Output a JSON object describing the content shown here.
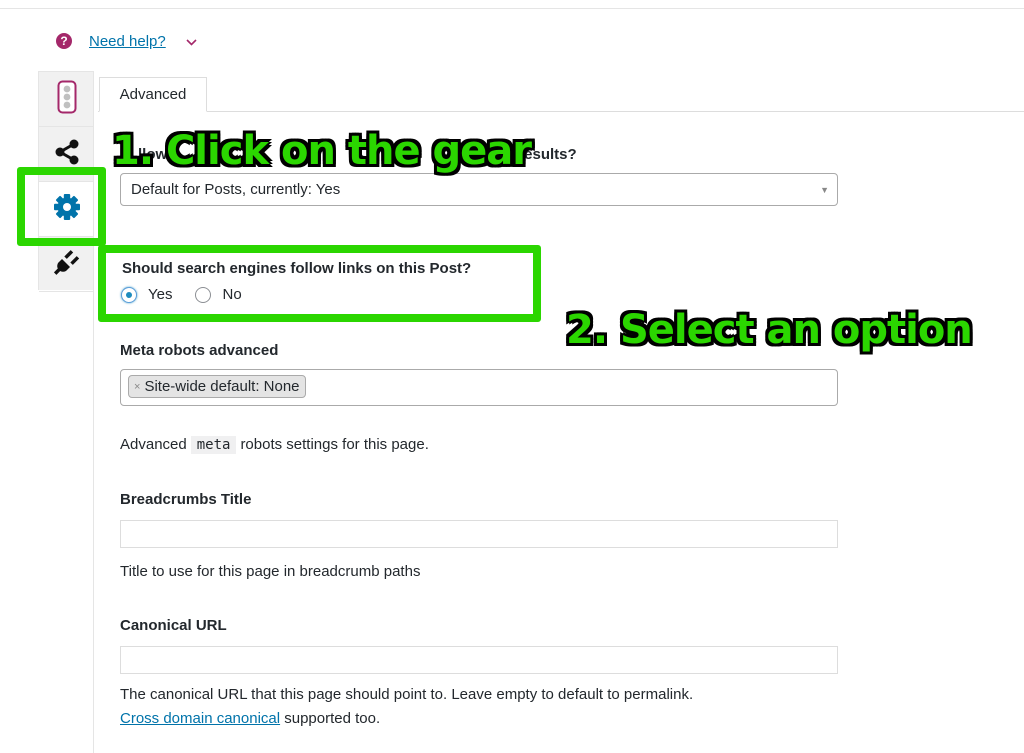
{
  "help": {
    "link_text": "Need help?",
    "icon": "question-circle-icon",
    "chevron": "chevron-down-icon"
  },
  "side_tabs": [
    {
      "name": "readability",
      "icon": "traffic-light-icon",
      "active": false
    },
    {
      "name": "social",
      "icon": "share-icon",
      "active": false
    },
    {
      "name": "advanced",
      "icon": "gear-icon",
      "active": true
    },
    {
      "name": "plugins",
      "icon": "plug-icon",
      "active": false
    }
  ],
  "tab": {
    "label": "Advanced"
  },
  "annotations": {
    "step1": "1. Click on the gear",
    "step2": "2. Select an option",
    "color": "#2bd600"
  },
  "search_results": {
    "label_visible_start": "llow",
    "label_visible_middle": "n",
    "label_visible_end": "h results?",
    "selected": "Default for Posts, currently: Yes"
  },
  "follow_links": {
    "label": "Should search engines follow links on this Post?",
    "options": [
      "Yes",
      "No"
    ],
    "selected": "Yes"
  },
  "meta_robots": {
    "label": "Meta robots advanced",
    "chip": "Site-wide default: None",
    "desc_before": "Advanced",
    "desc_code": "meta",
    "desc_after": "robots settings for this page."
  },
  "breadcrumbs": {
    "label": "Breadcrumbs Title",
    "value": "",
    "desc": "Title to use for this page in breadcrumb paths"
  },
  "canonical": {
    "label": "Canonical URL",
    "value": "",
    "desc": "The canonical URL that this page should point to. Leave empty to default to permalink.",
    "link": "Cross domain canonical",
    "link_after": "supported too."
  },
  "colors": {
    "accent": "#a4286a",
    "link": "#0073aa",
    "highlight": "#2bd600",
    "active_icon": "#0073aa"
  }
}
